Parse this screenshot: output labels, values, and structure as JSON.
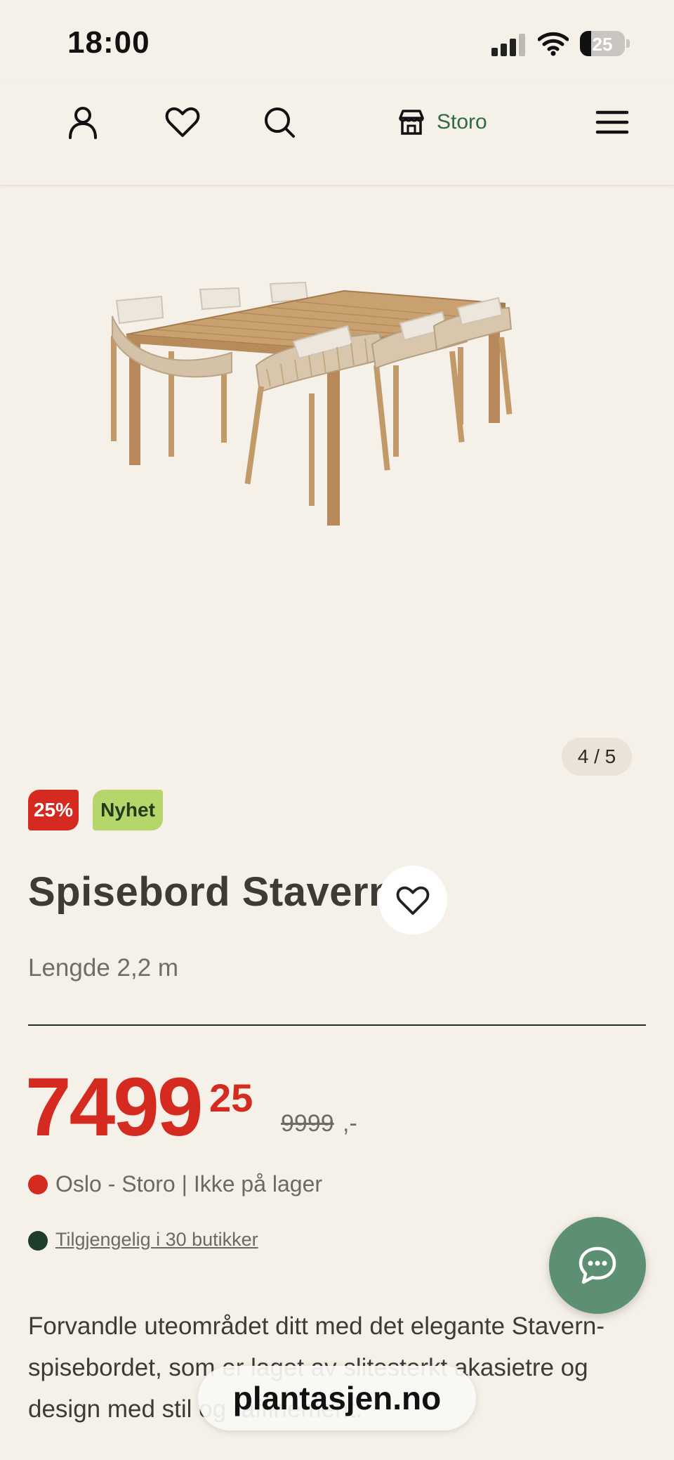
{
  "status_bar": {
    "time": "18:00",
    "battery_level": "25",
    "signal_icon": "cellular-signal-icon",
    "wifi_icon": "wifi-icon",
    "battery_icon": "battery-icon"
  },
  "nav": {
    "account_icon": "person-icon",
    "favorites_icon": "heart-icon",
    "search_icon": "search-icon",
    "store_icon": "store-icon",
    "store_name": "Storo",
    "menu_icon": "hamburger-menu-icon"
  },
  "gallery": {
    "counter": "4 / 5"
  },
  "product": {
    "badges": {
      "sale": "25%",
      "new": "Nyhet"
    },
    "title": "Spisebord Stavern",
    "subtitle": "Lengde 2,2 m",
    "price": {
      "main": "7499",
      "cents": "25",
      "old": "9999",
      "old_suffix": ",-"
    },
    "stock": {
      "text": "Oslo - Storo | Ikke på lager",
      "color": "#d42a1f"
    },
    "availability": {
      "text": "Tilgjengelig i 30 butikker",
      "color": "#1d3f2a"
    },
    "description": "Forvandle uteområdet ditt med det elegante Stavern-spisebordet, som er laget av slitesterkt akasietre og design med stil og raffinement."
  },
  "colors": {
    "background": "#f5f0e8",
    "sale_red": "#d42a1f",
    "new_green": "#b5d66b",
    "brand_green": "#2f6b45",
    "chat_green": "#5d8f72"
  },
  "chat": {
    "icon": "chat-bubble-icon"
  },
  "browser": {
    "url": "plantasjen.no"
  }
}
